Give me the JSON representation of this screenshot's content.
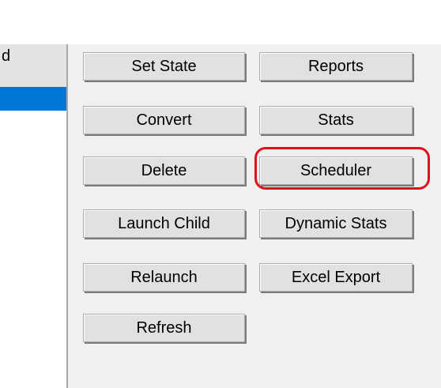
{
  "list": {
    "header_text": "d"
  },
  "buttons": {
    "set_state": "Set State",
    "reports": "Reports",
    "convert": "Convert",
    "stats": "Stats",
    "delete": "Delete",
    "scheduler": "Scheduler",
    "launch_child": "Launch Child",
    "dynamic_stats": "Dynamic Stats",
    "relaunch": "Relaunch",
    "excel_export": "Excel Export",
    "refresh": "Refresh"
  },
  "annotation": {
    "color": "#e0101a",
    "target": "scheduler"
  }
}
